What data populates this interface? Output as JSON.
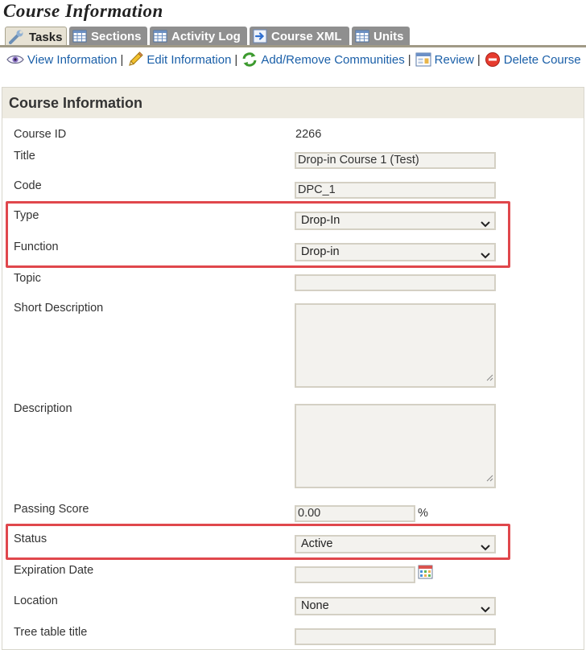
{
  "page": {
    "title": "Course Information"
  },
  "tabs": [
    {
      "label": "Tasks",
      "icon": "wrench-icon",
      "active": true
    },
    {
      "label": "Sections",
      "icon": "table-icon"
    },
    {
      "label": "Activity Log",
      "icon": "table-icon"
    },
    {
      "label": "Course XML",
      "icon": "xml-arrow-icon"
    },
    {
      "label": "Units",
      "icon": "table-icon"
    }
  ],
  "actions": [
    {
      "label": "View Information",
      "icon": "eye-icon"
    },
    {
      "label": "Edit Information",
      "icon": "pencil-icon"
    },
    {
      "label": "Add/Remove Communities",
      "icon": "refresh-arrows-icon"
    },
    {
      "label": "Review",
      "icon": "review-form-icon"
    },
    {
      "label": "Delete Course",
      "icon": "delete-icon"
    }
  ],
  "actions_separator": "|",
  "panel": {
    "heading": "Course Information"
  },
  "fields": {
    "course_id": {
      "label": "Course ID",
      "value": "2266"
    },
    "title": {
      "label": "Title",
      "value": "Drop-in Course 1 (Test)"
    },
    "code": {
      "label": "Code",
      "value": "DPC_1"
    },
    "type": {
      "label": "Type",
      "value": "Drop-In"
    },
    "function": {
      "label": "Function",
      "value": "Drop-in"
    },
    "topic": {
      "label": "Topic",
      "value": ""
    },
    "short_description": {
      "label": "Short Description",
      "value": ""
    },
    "description": {
      "label": "Description",
      "value": ""
    },
    "passing_score": {
      "label": "Passing Score",
      "value": "0.00",
      "unit": "%"
    },
    "status": {
      "label": "Status",
      "value": "Active"
    },
    "expiration_date": {
      "label": "Expiration Date",
      "value": "",
      "icon": "calendar-icon"
    },
    "location": {
      "label": "Location",
      "value": "None"
    },
    "tree_table_title": {
      "label": "Tree table title",
      "value": ""
    }
  },
  "colors": {
    "link": "#1a5fa8",
    "highlight": "#e0474c",
    "tab_inactive": "#8f8f8f",
    "tab_active": "#e7e2d4",
    "panel_header": "#eeebe1"
  }
}
